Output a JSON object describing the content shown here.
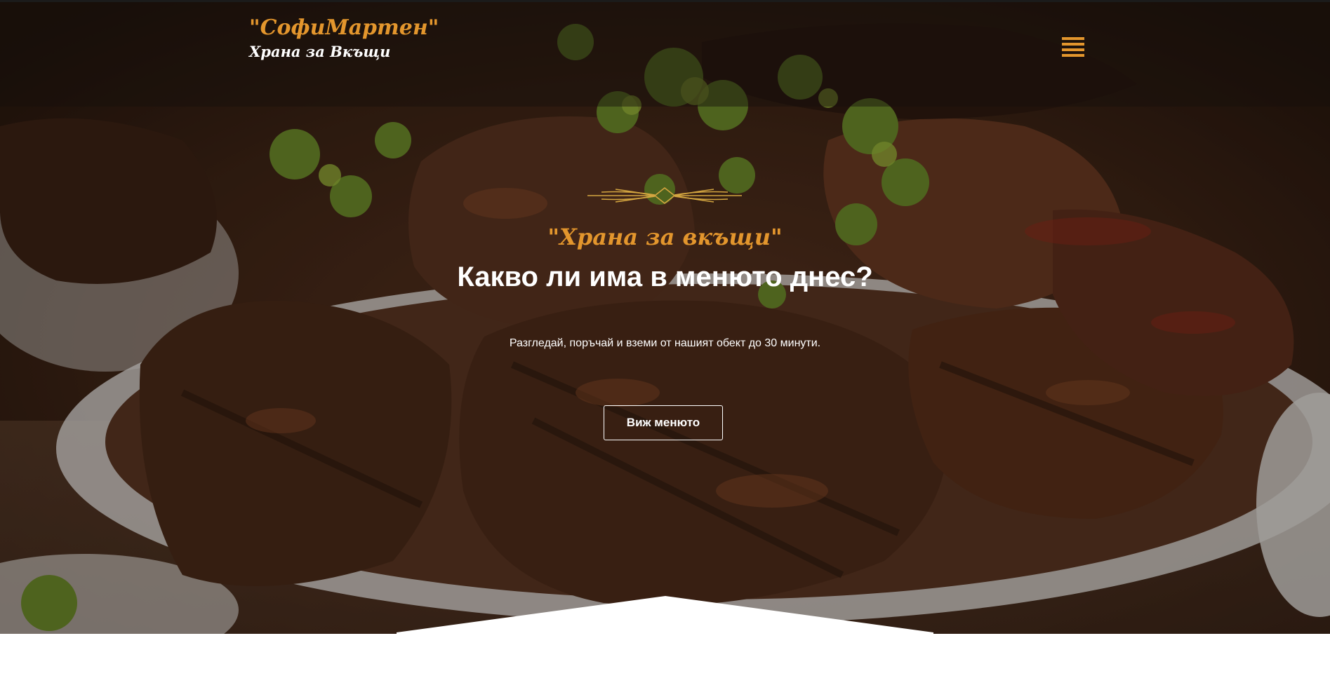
{
  "brand": {
    "name": "\"СофиМартен\"",
    "tagline": "Храна за Вкъщи",
    "accent_color": "#e3962d"
  },
  "header": {
    "menu_icon": "hamburger-menu-icon"
  },
  "hero": {
    "kicker": "\"Храна за вкъщи\"",
    "headline": "Какво ли има в менюто днес?",
    "subtext": "Разгледай, поръчай и вземи от нашият обект до 30 минути.",
    "cta_label": "Виж менюто",
    "background_image": "grilled meat steaks with parsley on a white plate",
    "ornament_icon": "decorative-line-ornament-icon"
  }
}
